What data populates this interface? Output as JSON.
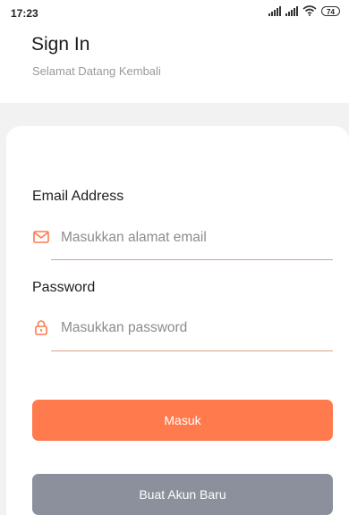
{
  "status": {
    "time": "17:23",
    "battery": "74"
  },
  "header": {
    "title": "Sign In",
    "subtitle": "Selamat Datang Kembali"
  },
  "form": {
    "email_label": "Email Address",
    "email_placeholder": "Masukkan alamat email",
    "password_label": "Password",
    "password_placeholder": "Masukkan password"
  },
  "actions": {
    "login_label": "Masuk",
    "register_label": "Buat Akun Baru"
  },
  "colors": {
    "accent": "#ff7a4d",
    "secondary_button": "#8c909c",
    "underline": "#d9a489"
  },
  "icons": {
    "email": "mail-icon",
    "password": "lock-icon"
  }
}
